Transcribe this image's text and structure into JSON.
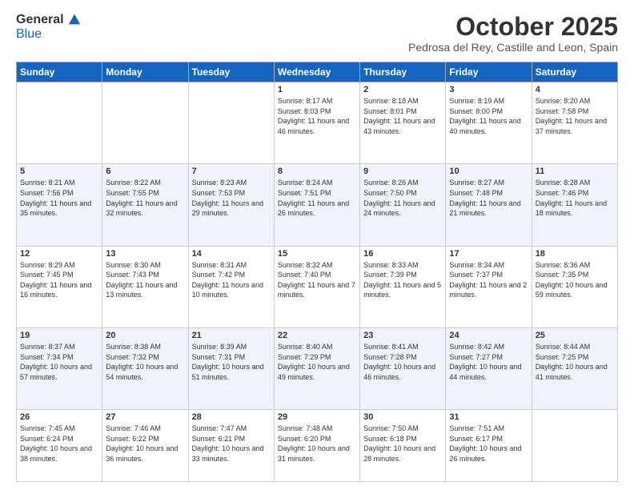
{
  "logo": {
    "general": "General",
    "blue": "Blue"
  },
  "header": {
    "month": "October 2025",
    "location": "Pedrosa del Rey, Castille and Leon, Spain"
  },
  "days_of_week": [
    "Sunday",
    "Monday",
    "Tuesday",
    "Wednesday",
    "Thursday",
    "Friday",
    "Saturday"
  ],
  "weeks": [
    [
      {
        "day": "",
        "sunrise": "",
        "sunset": "",
        "daylight": ""
      },
      {
        "day": "",
        "sunrise": "",
        "sunset": "",
        "daylight": ""
      },
      {
        "day": "",
        "sunrise": "",
        "sunset": "",
        "daylight": ""
      },
      {
        "day": "1",
        "sunrise": "Sunrise: 8:17 AM",
        "sunset": "Sunset: 8:03 PM",
        "daylight": "Daylight: 11 hours and 46 minutes."
      },
      {
        "day": "2",
        "sunrise": "Sunrise: 8:18 AM",
        "sunset": "Sunset: 8:01 PM",
        "daylight": "Daylight: 11 hours and 43 minutes."
      },
      {
        "day": "3",
        "sunrise": "Sunrise: 8:19 AM",
        "sunset": "Sunset: 8:00 PM",
        "daylight": "Daylight: 11 hours and 40 minutes."
      },
      {
        "day": "4",
        "sunrise": "Sunrise: 8:20 AM",
        "sunset": "Sunset: 7:58 PM",
        "daylight": "Daylight: 11 hours and 37 minutes."
      }
    ],
    [
      {
        "day": "5",
        "sunrise": "Sunrise: 8:21 AM",
        "sunset": "Sunset: 7:56 PM",
        "daylight": "Daylight: 11 hours and 35 minutes."
      },
      {
        "day": "6",
        "sunrise": "Sunrise: 8:22 AM",
        "sunset": "Sunset: 7:55 PM",
        "daylight": "Daylight: 11 hours and 32 minutes."
      },
      {
        "day": "7",
        "sunrise": "Sunrise: 8:23 AM",
        "sunset": "Sunset: 7:53 PM",
        "daylight": "Daylight: 11 hours and 29 minutes."
      },
      {
        "day": "8",
        "sunrise": "Sunrise: 8:24 AM",
        "sunset": "Sunset: 7:51 PM",
        "daylight": "Daylight: 11 hours and 26 minutes."
      },
      {
        "day": "9",
        "sunrise": "Sunrise: 8:26 AM",
        "sunset": "Sunset: 7:50 PM",
        "daylight": "Daylight: 11 hours and 24 minutes."
      },
      {
        "day": "10",
        "sunrise": "Sunrise: 8:27 AM",
        "sunset": "Sunset: 7:48 PM",
        "daylight": "Daylight: 11 hours and 21 minutes."
      },
      {
        "day": "11",
        "sunrise": "Sunrise: 8:28 AM",
        "sunset": "Sunset: 7:46 PM",
        "daylight": "Daylight: 11 hours and 18 minutes."
      }
    ],
    [
      {
        "day": "12",
        "sunrise": "Sunrise: 8:29 AM",
        "sunset": "Sunset: 7:45 PM",
        "daylight": "Daylight: 11 hours and 16 minutes."
      },
      {
        "day": "13",
        "sunrise": "Sunrise: 8:30 AM",
        "sunset": "Sunset: 7:43 PM",
        "daylight": "Daylight: 11 hours and 13 minutes."
      },
      {
        "day": "14",
        "sunrise": "Sunrise: 8:31 AM",
        "sunset": "Sunset: 7:42 PM",
        "daylight": "Daylight: 11 hours and 10 minutes."
      },
      {
        "day": "15",
        "sunrise": "Sunrise: 8:32 AM",
        "sunset": "Sunset: 7:40 PM",
        "daylight": "Daylight: 11 hours and 7 minutes."
      },
      {
        "day": "16",
        "sunrise": "Sunrise: 8:33 AM",
        "sunset": "Sunset: 7:39 PM",
        "daylight": "Daylight: 11 hours and 5 minutes."
      },
      {
        "day": "17",
        "sunrise": "Sunrise: 8:34 AM",
        "sunset": "Sunset: 7:37 PM",
        "daylight": "Daylight: 11 hours and 2 minutes."
      },
      {
        "day": "18",
        "sunrise": "Sunrise: 8:36 AM",
        "sunset": "Sunset: 7:35 PM",
        "daylight": "Daylight: 10 hours and 59 minutes."
      }
    ],
    [
      {
        "day": "19",
        "sunrise": "Sunrise: 8:37 AM",
        "sunset": "Sunset: 7:34 PM",
        "daylight": "Daylight: 10 hours and 57 minutes."
      },
      {
        "day": "20",
        "sunrise": "Sunrise: 8:38 AM",
        "sunset": "Sunset: 7:32 PM",
        "daylight": "Daylight: 10 hours and 54 minutes."
      },
      {
        "day": "21",
        "sunrise": "Sunrise: 8:39 AM",
        "sunset": "Sunset: 7:31 PM",
        "daylight": "Daylight: 10 hours and 51 minutes."
      },
      {
        "day": "22",
        "sunrise": "Sunrise: 8:40 AM",
        "sunset": "Sunset: 7:29 PM",
        "daylight": "Daylight: 10 hours and 49 minutes."
      },
      {
        "day": "23",
        "sunrise": "Sunrise: 8:41 AM",
        "sunset": "Sunset: 7:28 PM",
        "daylight": "Daylight: 10 hours and 46 minutes."
      },
      {
        "day": "24",
        "sunrise": "Sunrise: 8:42 AM",
        "sunset": "Sunset: 7:27 PM",
        "daylight": "Daylight: 10 hours and 44 minutes."
      },
      {
        "day": "25",
        "sunrise": "Sunrise: 8:44 AM",
        "sunset": "Sunset: 7:25 PM",
        "daylight": "Daylight: 10 hours and 41 minutes."
      }
    ],
    [
      {
        "day": "26",
        "sunrise": "Sunrise: 7:45 AM",
        "sunset": "Sunset: 6:24 PM",
        "daylight": "Daylight: 10 hours and 38 minutes."
      },
      {
        "day": "27",
        "sunrise": "Sunrise: 7:46 AM",
        "sunset": "Sunset: 6:22 PM",
        "daylight": "Daylight: 10 hours and 36 minutes."
      },
      {
        "day": "28",
        "sunrise": "Sunrise: 7:47 AM",
        "sunset": "Sunset: 6:21 PM",
        "daylight": "Daylight: 10 hours and 33 minutes."
      },
      {
        "day": "29",
        "sunrise": "Sunrise: 7:48 AM",
        "sunset": "Sunset: 6:20 PM",
        "daylight": "Daylight: 10 hours and 31 minutes."
      },
      {
        "day": "30",
        "sunrise": "Sunrise: 7:50 AM",
        "sunset": "Sunset: 6:18 PM",
        "daylight": "Daylight: 10 hours and 28 minutes."
      },
      {
        "day": "31",
        "sunrise": "Sunrise: 7:51 AM",
        "sunset": "Sunset: 6:17 PM",
        "daylight": "Daylight: 10 hours and 26 minutes."
      },
      {
        "day": "",
        "sunrise": "",
        "sunset": "",
        "daylight": ""
      }
    ]
  ]
}
